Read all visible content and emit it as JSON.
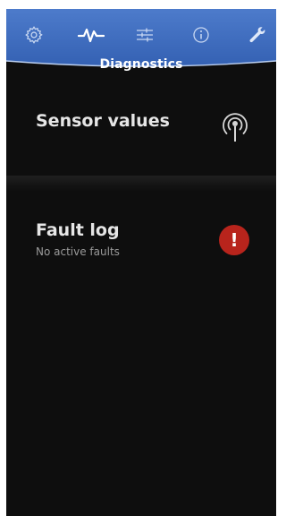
{
  "colors": {
    "header_top": "#4a78c8",
    "header_bottom": "#3563b6",
    "background": "#0e0e0e",
    "fault_badge": "#b8241c"
  },
  "header": {
    "title": "Diagnostics",
    "nav": [
      {
        "icon": "gear-icon",
        "active": false
      },
      {
        "icon": "pulse-icon",
        "active": true
      },
      {
        "icon": "sliders-icon",
        "active": false
      },
      {
        "icon": "info-icon",
        "active": false
      },
      {
        "icon": "wrench-icon",
        "active": false
      }
    ]
  },
  "sensor_card": {
    "title": "Sensor values",
    "icon": "antenna-signal-icon"
  },
  "fault_card": {
    "title": "Fault log",
    "subtitle": "No active faults",
    "badge": "!",
    "icon": "alert-icon"
  }
}
